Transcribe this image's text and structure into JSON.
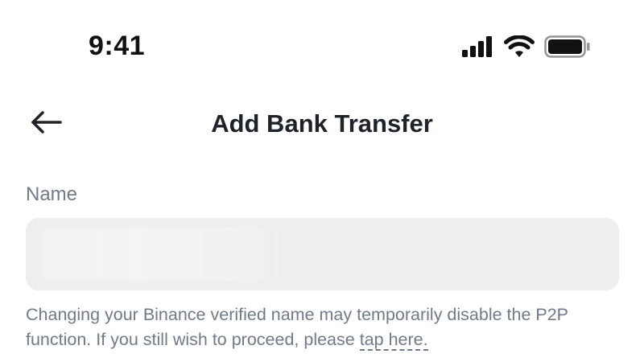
{
  "status_bar": {
    "time": "9:41",
    "icons": [
      "cellular-signal-icon",
      "wifi-icon",
      "battery-icon"
    ]
  },
  "nav": {
    "back_icon": "arrow-left-icon",
    "title": "Add Bank Transfer"
  },
  "form": {
    "name_label": "Name",
    "name_value": ""
  },
  "helper": {
    "text_before_link": "Changing your Binance verified name may temporarily disable the P2P function. If you still wish to proceed, please ",
    "link_text": "tap here."
  },
  "colors": {
    "text_primary": "#1e2329",
    "text_secondary": "#707a8a",
    "input_bg": "#eeeeee"
  }
}
